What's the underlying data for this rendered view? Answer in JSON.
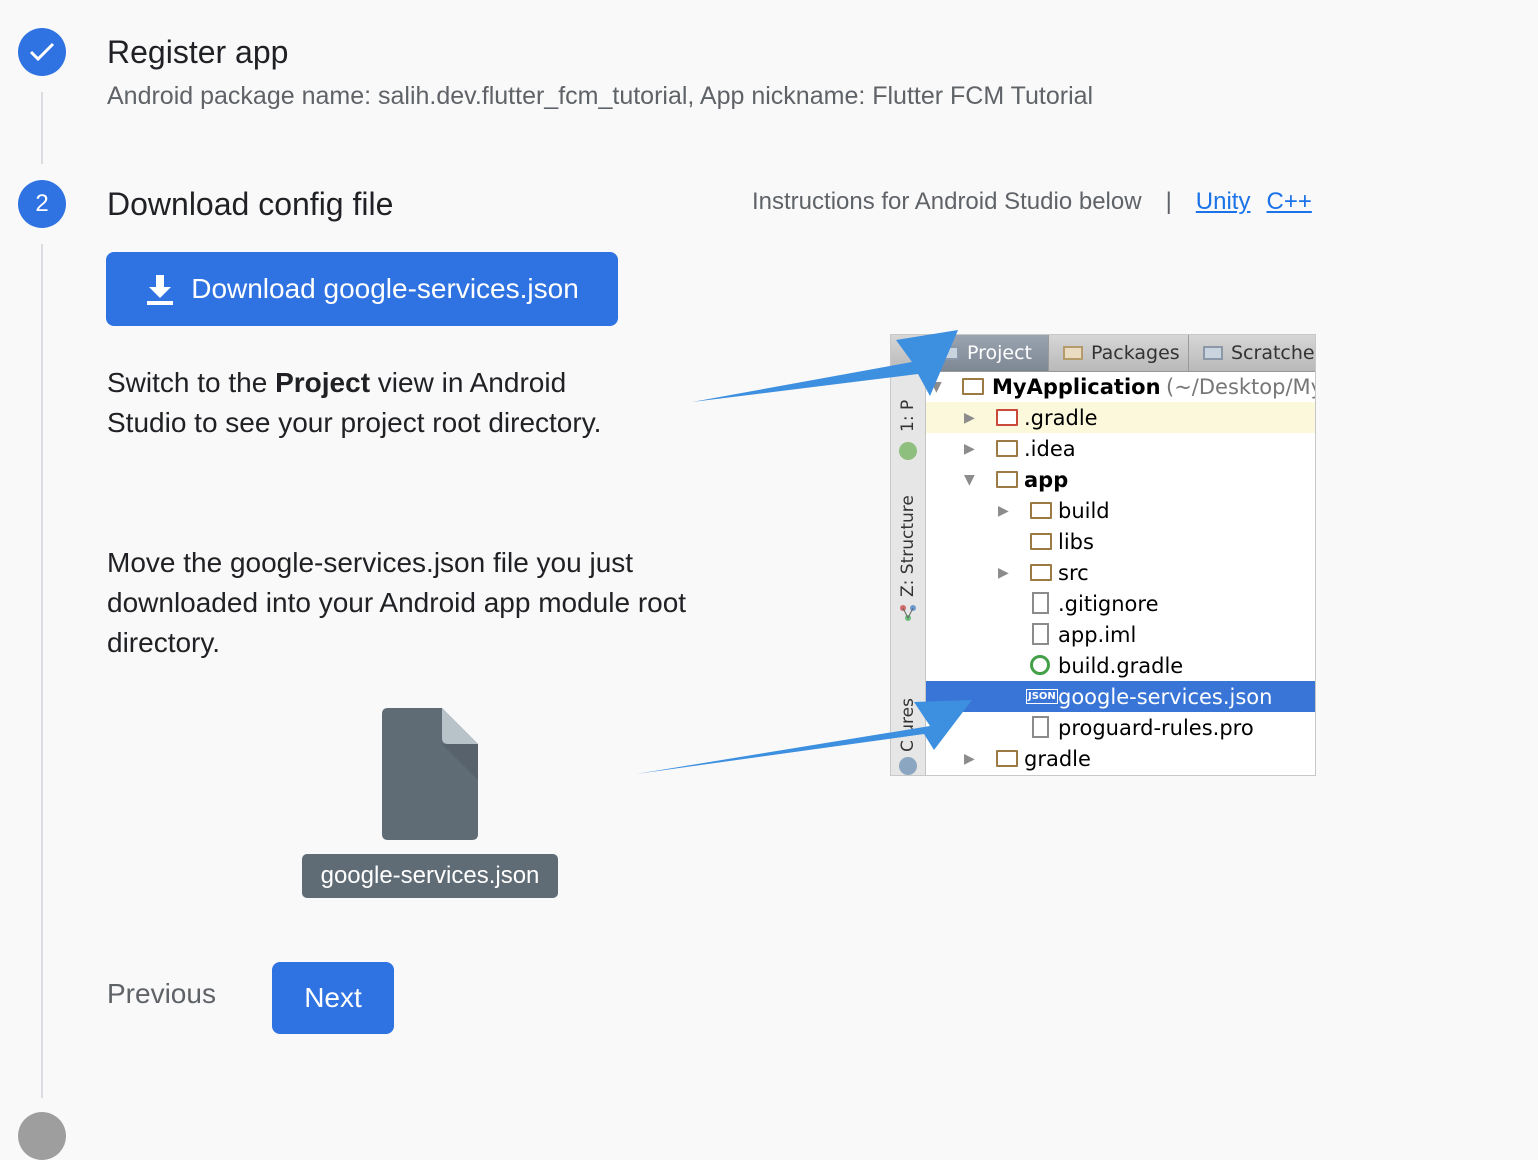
{
  "step1": {
    "title": "Register app",
    "subtitle": "Android package name: salih.dev.flutter_fcm_tutorial, App nickname: Flutter FCM Tutorial"
  },
  "step2": {
    "number": "2",
    "title": "Download config file",
    "instructions": "Instructions for Android Studio below",
    "separator": "|",
    "link_unity": "Unity",
    "link_cpp": "C++",
    "download_label": "Download google-services.json",
    "para1_a": "Switch to the ",
    "para1_b": "Project",
    "para1_c": " view in Android",
    "para1_d": "Studio to see your project root directory.",
    "para2_a": "Move the google-services.json file you just",
    "para2_b": "downloaded into your Android app module root",
    "para2_c": "directory.",
    "file_name": "google-services.json",
    "previous_label": "Previous",
    "next_label": "Next"
  },
  "ide": {
    "tabs": [
      "Project",
      "Packages",
      "Scratche:"
    ],
    "side_labels": [
      "1: P",
      "Z: Structure",
      "C  ures"
    ],
    "tree": [
      {
        "label": "MyApplication",
        "extra": "(~/Desktop/My",
        "bold": true
      },
      {
        "label": ".gradle"
      },
      {
        "label": ".idea"
      },
      {
        "label": "app",
        "bold": true
      },
      {
        "label": "build"
      },
      {
        "label": "libs"
      },
      {
        "label": "src"
      },
      {
        "label": ".gitignore"
      },
      {
        "label": "app.iml"
      },
      {
        "label": "build.gradle"
      },
      {
        "label": "google-services.json",
        "selected": true
      },
      {
        "label": "proguard-rules.pro"
      },
      {
        "label": "gradle"
      }
    ]
  },
  "colors": {
    "primary": "#2f72e2",
    "link": "#1a73e8",
    "arrow": "#3d8fe0",
    "file_icon": "#5f6b75",
    "selection": "#3875d7"
  }
}
